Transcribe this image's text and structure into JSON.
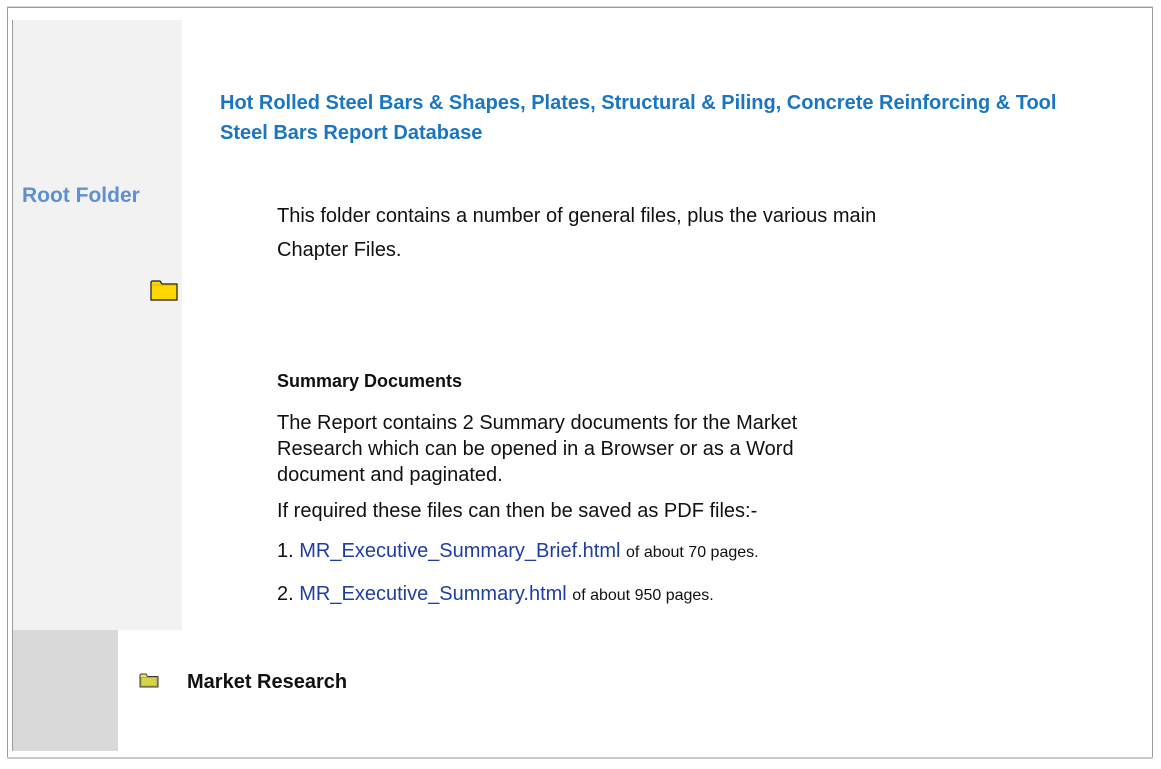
{
  "header": {
    "title": "Hot Rolled Steel Bars & Shapes, Plates, Structural & Piling, Concrete Reinforcing & Tool Steel Bars Report Database"
  },
  "sidebar": {
    "root_folder_label": "Root Folder",
    "root_folder_icon": "folder-icon"
  },
  "content": {
    "intro": "This folder contains a number of general files, plus the various main Chapter Files.",
    "summary_heading": "Summary Documents",
    "summary_description": "The Report contains 2 Summary documents for the Market Research which can be opened in a Browser or as a Word document and paginated.",
    "saved_note": "If required these files can then be saved as PDF files:-",
    "documents": [
      {
        "number": "1.",
        "link": "MR_Executive_Summary_Brief.html",
        "pages": "of about 70 pages."
      },
      {
        "number": "2.",
        "link": "MR_Executive_Summary.html",
        "pages": "of about 950 pages."
      }
    ]
  },
  "folders": {
    "market_research_label": "Market Research",
    "market_research_icon": "folder-icon"
  },
  "colors": {
    "title": "#1a76c2",
    "root_folder": "#5f8fd0",
    "link": "#1f3fa0",
    "folder_fill": "#ffd700",
    "panel_light": "#f2f2f2",
    "panel_dark": "#d9d9d9"
  }
}
